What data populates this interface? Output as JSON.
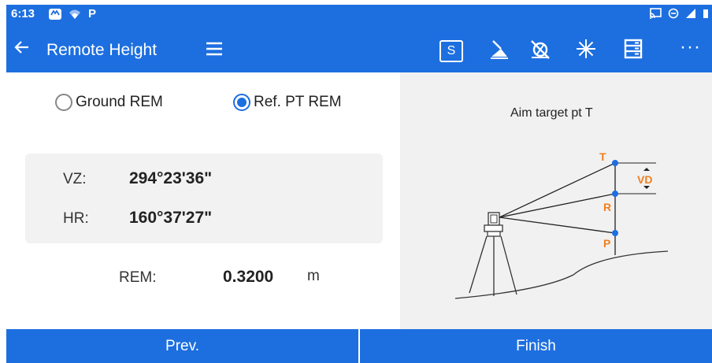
{
  "status_bar": {
    "time": "6:13",
    "app_badge": "P"
  },
  "app_bar": {
    "title": "Remote Height",
    "s_button_label": "S",
    "more_label": "···",
    "color": "#1d6fe0"
  },
  "modes": [
    {
      "label": "Ground REM",
      "selected": false
    },
    {
      "label": "Ref. PT REM",
      "selected": true
    }
  ],
  "angles": {
    "vz_label": "VZ:",
    "vz_value": "294°23'36\"",
    "hr_label": "HR:",
    "hr_value": "160°37'27\""
  },
  "rem": {
    "label": "REM:",
    "value": "0.3200",
    "unit": "m"
  },
  "diagram": {
    "hint": "Aim target pt T",
    "point_t": "T",
    "point_r": "R",
    "point_p": "P",
    "vd_label": "VD",
    "accent_color": "#f07f1e"
  },
  "bottom": {
    "prev_label": "Prev.",
    "finish_label": "Finish"
  }
}
